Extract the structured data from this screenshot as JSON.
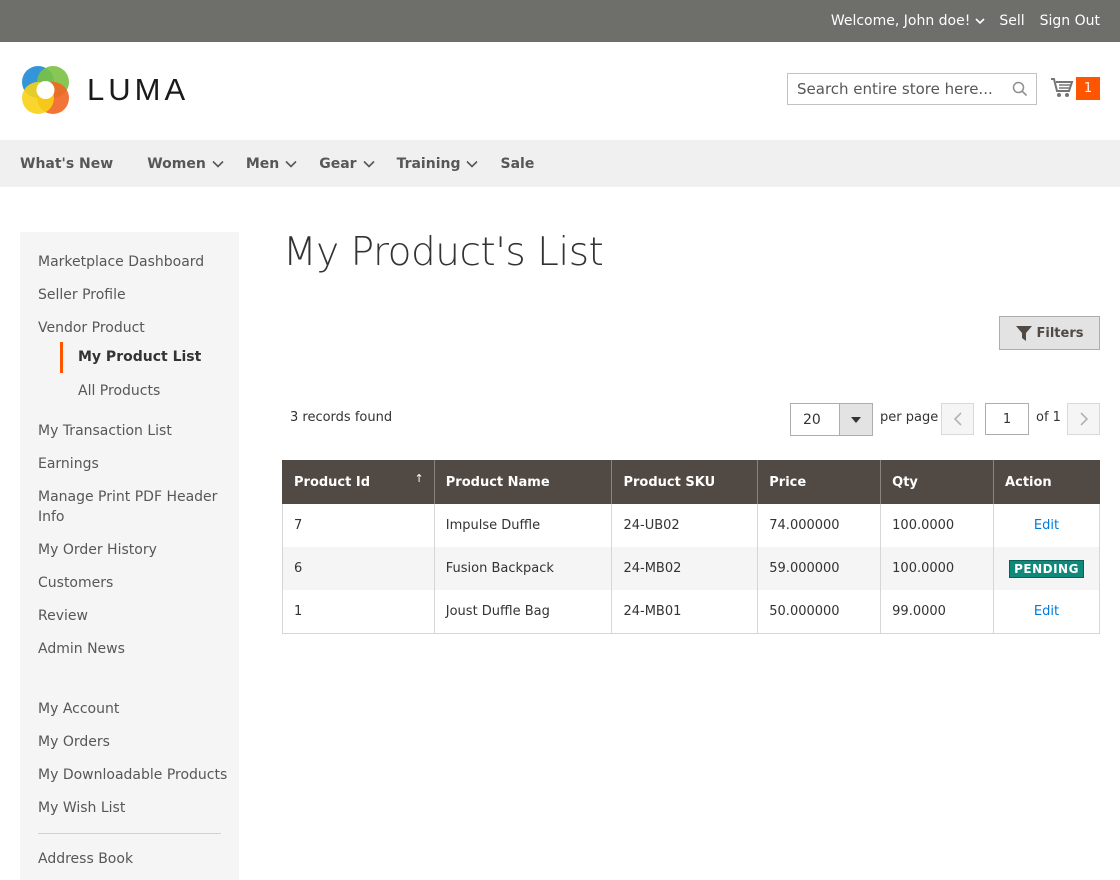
{
  "topbar": {
    "welcome": "Welcome, John doe!",
    "sell": "Sell",
    "sign_out": "Sign Out"
  },
  "header": {
    "logo_text": "LUMA",
    "search_placeholder": "Search entire store here...",
    "cart_count": "1"
  },
  "nav": {
    "items": [
      "What's New",
      "Women",
      "Men",
      "Gear",
      "Training",
      "Sale"
    ]
  },
  "sidebar": {
    "items": [
      "Marketplace Dashboard",
      "Seller Profile",
      "Vendor Product",
      "My Product List",
      "All Products",
      "My Transaction List",
      "Earnings",
      "Manage Print PDF Header Info",
      "My Order History",
      "Customers",
      "Review",
      "Admin News",
      "My Account",
      "My Orders",
      "My Downloadable Products",
      "My Wish List",
      "Address Book"
    ]
  },
  "main": {
    "title": "My Product's List",
    "filters_label": "Filters",
    "records_found": "3 records found",
    "per_page_value": "20",
    "per_page_label": "per page",
    "page_value": "1",
    "page_total": "of 1"
  },
  "table": {
    "headers": [
      "Product Id",
      "Product Name",
      "Product SKU",
      "Price",
      "Qty",
      "Action"
    ],
    "sort_indicator": "↑",
    "rows": [
      {
        "id": "7",
        "name": "Impulse Duffle",
        "sku": "24-UB02",
        "price": "74.000000",
        "qty": "100.0000",
        "action": "Edit"
      },
      {
        "id": "6",
        "name": "Fusion Backpack",
        "sku": "24-MB02",
        "price": "59.000000",
        "qty": "100.0000",
        "action": "PENDING"
      },
      {
        "id": "1",
        "name": "Joust Duffle Bag",
        "sku": "24-MB01",
        "price": "50.000000",
        "qty": "99.0000",
        "action": "Edit"
      }
    ]
  },
  "colors": {
    "accent": "#ff5501",
    "table_header": "#514943",
    "link": "#007bdb",
    "badge": "#10897b"
  },
  "icons": {
    "welcome_chevron": "chevron-down-icon",
    "search": "search-icon",
    "cart": "cart-icon",
    "filter": "filter-icon",
    "prev": "chevron-left-icon",
    "next": "chevron-right-icon"
  }
}
